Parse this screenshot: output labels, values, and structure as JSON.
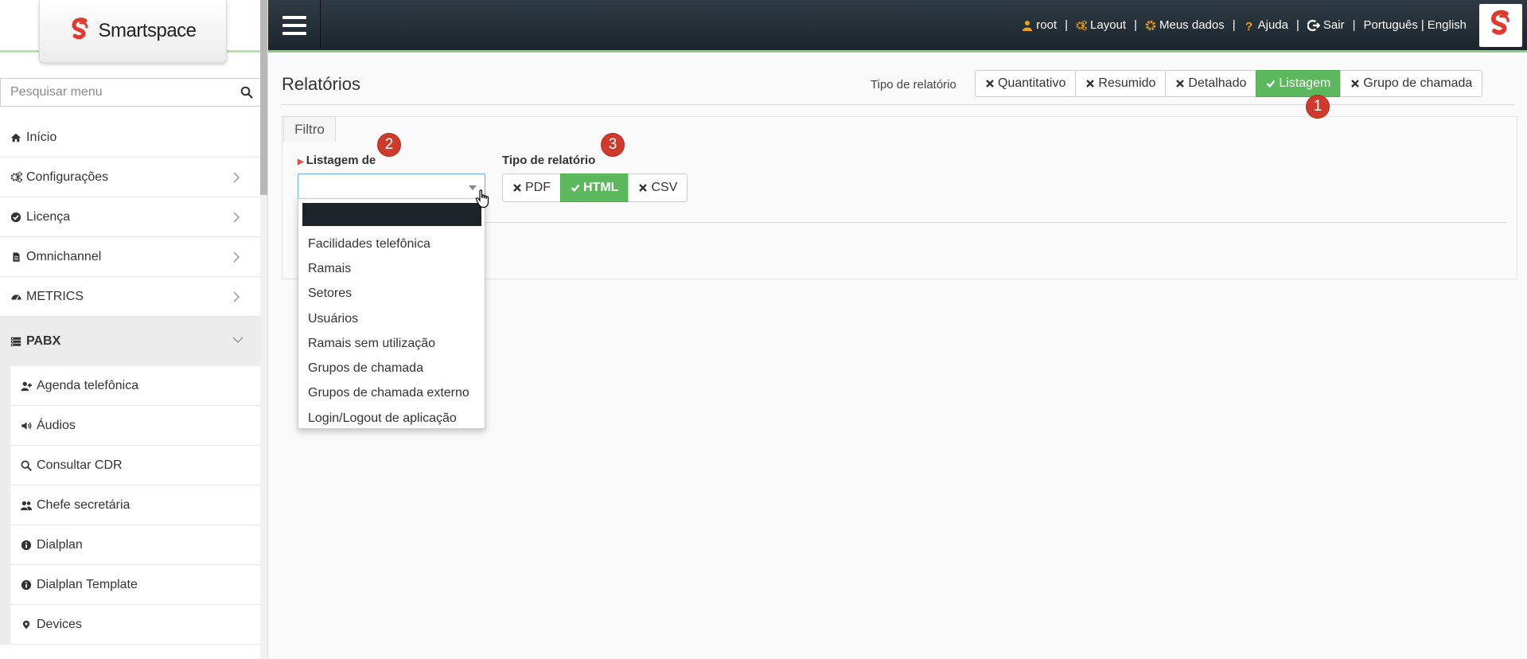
{
  "brand": {
    "name": "Smartspace"
  },
  "sidebar": {
    "search_placeholder": "Pesquisar menu",
    "items": [
      {
        "label": "Início",
        "icon": "home-icon"
      },
      {
        "label": "Configurações",
        "icon": "gears-icon"
      },
      {
        "label": "Licença",
        "icon": "check-circle-icon"
      },
      {
        "label": "Omnichannel",
        "icon": "document-icon"
      },
      {
        "label": "METRICS",
        "icon": "dashboard-icon"
      },
      {
        "label": "PABX",
        "icon": "server-icon"
      }
    ],
    "pabx_subitems": [
      {
        "label": "Agenda telefônica",
        "icon": "user-plus-icon"
      },
      {
        "label": "Áudios",
        "icon": "volume-icon"
      },
      {
        "label": "Consultar CDR",
        "icon": "search-icon"
      },
      {
        "label": "Chefe secretária",
        "icon": "users-icon"
      },
      {
        "label": "Dialplan",
        "icon": "info-circle-icon"
      },
      {
        "label": "Dialplan Template",
        "icon": "info-circle-icon"
      },
      {
        "label": "Devices",
        "icon": "map-marker-icon"
      }
    ]
  },
  "topbar": {
    "user": "root",
    "layout": "Layout",
    "meus_dados": "Meus dados",
    "ajuda": "Ajuda",
    "sair": "Sair",
    "lang_pt": "Português",
    "lang_sep": "|",
    "lang_en": "English",
    "separator": "|"
  },
  "main": {
    "title": "Relatórios",
    "report_type_label": "Tipo de relatório",
    "report_types": [
      {
        "label": "Quantitativo",
        "selected": false
      },
      {
        "label": "Resumido",
        "selected": false
      },
      {
        "label": "Detalhado",
        "selected": false
      },
      {
        "label": "Listagem",
        "selected": true
      },
      {
        "label": "Grupo de chamada",
        "selected": false
      }
    ],
    "filter_tab": "Filtro",
    "listagem_label": "Listagem de",
    "output_label": "Tipo de relatório",
    "output_types": [
      {
        "label": "PDF",
        "selected": false
      },
      {
        "label": "HTML",
        "selected": true
      },
      {
        "label": "CSV",
        "selected": false
      }
    ],
    "dropdown_options": [
      "Facilidades telefônica",
      "Ramais",
      "Setores",
      "Usuários",
      "Ramais sem utilização",
      "Grupos de chamada",
      "Grupos de chamada externo",
      "Login/Logout de aplicação"
    ],
    "badges": [
      "1",
      "2",
      "3"
    ]
  },
  "colors": {
    "accent_green": "#5cb85c",
    "badge_red": "#d03a2c",
    "topbar_dark": "#1b252d",
    "brand_red": "#e03a2f"
  }
}
